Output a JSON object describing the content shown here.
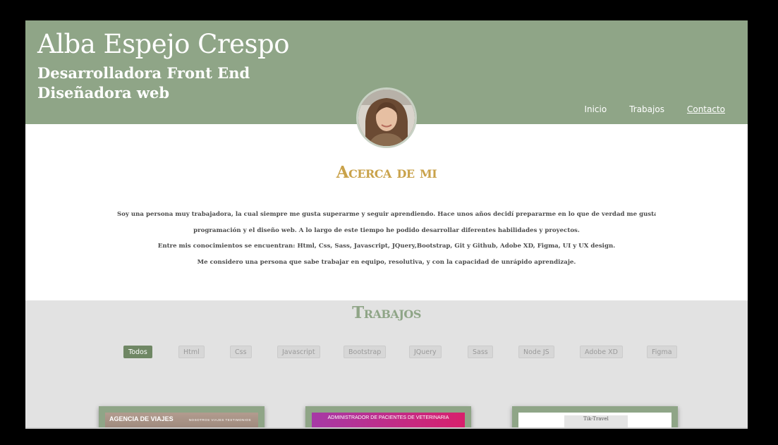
{
  "header": {
    "name": "Alba Espejo Crespo",
    "roles": [
      "Desarrolladora Front End",
      "Diseñadora web"
    ],
    "nav": [
      "Inicio",
      "Trabajos",
      "Contacto"
    ],
    "active_nav": "Contacto"
  },
  "about": {
    "title": "Acerca de mi",
    "paragraphs": [
      "Soy una persona muy trabajadora, la cual siempre me gusta superarme y seguir aprendiendo. Hace unos años decidí prepararme en lo que de verdad me gustaba, la",
      "programación y el diseño web. A lo largo de este tiempo he podido desarrollar diferentes habilidades y proyectos.",
      "Entre mis conocimientos se encuentran: Html, Css, Sass, Javascript, JQuery,Bootstrap, Git y Github, Adobe XD, Figma, UI y UX design.",
      "Me considero una persona que sabe trabajar en equipo, resolutiva, y con la capacidad de unrápido aprendizaje."
    ]
  },
  "works": {
    "title": "Trabajos",
    "filters": [
      "Todos",
      "Html",
      "Css",
      "Javascript",
      "Bootstrap",
      "JQuery",
      "Sass",
      "Node JS",
      "Adobe XD",
      "Figma"
    ],
    "active_filter": "Todos",
    "cards": [
      {
        "thumb_title": "AGENCIA DE VIAJES",
        "thumb_nav": "NOSOTROS  VIAJES  TESTIMONIOS"
      },
      {
        "thumb_title": "ADMINISTRADOR DE PACIENTES DE VETERINARIA"
      },
      {
        "thumb_title": "Tik-Travel"
      }
    ]
  },
  "colors": {
    "header_bg": "#8fa587",
    "about_title": "#c9a24a",
    "works_bg": "#e2e2e2",
    "filter_active": "#6f8764"
  }
}
